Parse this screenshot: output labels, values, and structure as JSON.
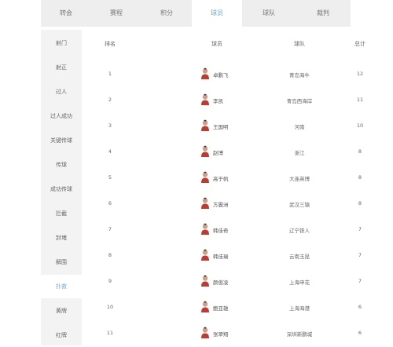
{
  "tabs": [
    {
      "label": "转会",
      "active": false
    },
    {
      "label": "赛程",
      "active": false
    },
    {
      "label": "积分",
      "active": false
    },
    {
      "label": "球员",
      "active": true
    },
    {
      "label": "球队",
      "active": false
    },
    {
      "label": "裁判",
      "active": false
    }
  ],
  "nav": [
    {
      "label": "射门",
      "active": false
    },
    {
      "label": "射正",
      "active": false
    },
    {
      "label": "过人",
      "active": false
    },
    {
      "label": "过人成功",
      "active": false
    },
    {
      "label": "关键传球",
      "active": false
    },
    {
      "label": "传球",
      "active": false
    },
    {
      "label": "成功传球",
      "active": false
    },
    {
      "label": "拦截",
      "active": false
    },
    {
      "label": "封堵",
      "active": false
    },
    {
      "label": "解围",
      "active": false
    },
    {
      "label": "扑救",
      "active": true
    },
    {
      "label": "黄牌",
      "active": false
    },
    {
      "label": "红牌",
      "active": false
    }
  ],
  "columns": {
    "rank": "排名",
    "player": "球员",
    "team": "球队",
    "total": "总计"
  },
  "rows": [
    {
      "rank": "1",
      "player": "卓鹏飞",
      "team": "青岛海牛",
      "total": "12"
    },
    {
      "rank": "2",
      "player": "李凯",
      "team": "青岛西海岸",
      "total": "11"
    },
    {
      "rank": "3",
      "player": "王国明",
      "team": "河南",
      "total": "10"
    },
    {
      "rank": "4",
      "player": "赵博",
      "team": "浙江",
      "total": "8"
    },
    {
      "rank": "5",
      "player": "高于帆",
      "team": "大连英博",
      "total": "8"
    },
    {
      "rank": "6",
      "player": "方震洲",
      "team": "武汉三镇",
      "total": "8"
    },
    {
      "rank": "7",
      "player": "韩佳奇",
      "team": "辽宁铁人",
      "total": "7"
    },
    {
      "rank": "8",
      "player": "韩佳瑞",
      "team": "云南玉昆",
      "total": "7"
    },
    {
      "rank": "9",
      "player": "颜俊凌",
      "team": "上海申花",
      "total": "7"
    },
    {
      "rank": "10",
      "player": "鲍亚雄",
      "team": "上海海港",
      "total": "6"
    },
    {
      "rank": "11",
      "player": "张翠翔",
      "team": "深圳新鹏城",
      "total": "6"
    }
  ],
  "colors": {
    "accent": "#6fa6d8",
    "tab_bg": "#eeeeee",
    "nav_bg": "#f3f3f3"
  }
}
